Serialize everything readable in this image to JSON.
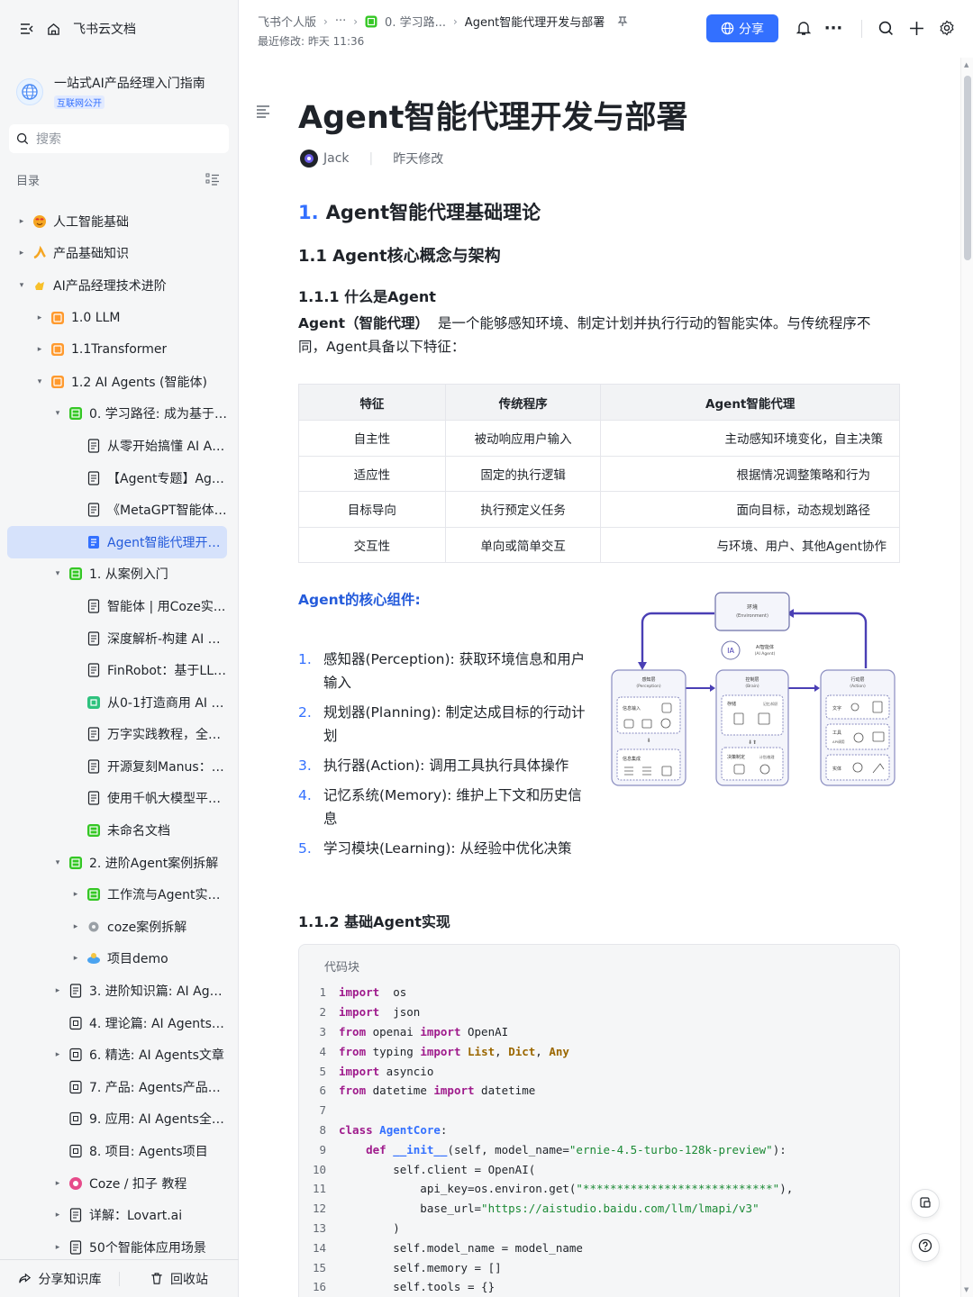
{
  "sidebar": {
    "app_title": "飞书云文档",
    "kb_title": "一站式AI产品经理入门指南",
    "kb_tag": "互联网公开",
    "search_placeholder": "搜索",
    "toc_label": "目录",
    "items": [
      {
        "label": "人工智能基础",
        "level": 0,
        "arrow": "▸",
        "icon": "emoji-red"
      },
      {
        "label": "产品基础知识",
        "level": 0,
        "arrow": "▸",
        "icon": "emoji-orange"
      },
      {
        "label": "AI产品经理技术进阶",
        "level": 0,
        "arrow": "▾",
        "icon": "emoji-yellow"
      },
      {
        "label": "1.0 LLM",
        "level": 1,
        "arrow": "▸",
        "icon": "folder-orange"
      },
      {
        "label": "1.1Transformer",
        "level": 1,
        "arrow": "▸",
        "icon": "folder-orange"
      },
      {
        "label": "1.2 AI Agents (智能体)",
        "level": 1,
        "arrow": "▾",
        "icon": "folder-orange"
      },
      {
        "label": "0. 学习路径: 成为基于A...",
        "level": 2,
        "arrow": "▾",
        "icon": "sheet-green"
      },
      {
        "label": "从零开始搞懂 AI Ag...",
        "level": 3,
        "arrow": "",
        "icon": "doc"
      },
      {
        "label": "【Agent专题】Agen...",
        "level": 3,
        "arrow": "",
        "icon": "doc"
      },
      {
        "label": "《MetaGPT智能体开...",
        "level": 3,
        "arrow": "",
        "icon": "doc"
      },
      {
        "label": "Agent智能代理开发...",
        "level": 3,
        "arrow": "",
        "icon": "doc-blue",
        "active": true
      },
      {
        "label": "1. 从案例入门",
        "level": 2,
        "arrow": "▾",
        "icon": "sheet-green"
      },
      {
        "label": "智能体 | 用Coze实...",
        "level": 3,
        "arrow": "",
        "icon": "doc"
      },
      {
        "label": "深度解析-构建 AI A...",
        "level": 3,
        "arrow": "",
        "icon": "doc"
      },
      {
        "label": "FinRobot：基于LLM...",
        "level": 3,
        "arrow": "",
        "icon": "doc"
      },
      {
        "label": "从0-1打造商用 AI A...",
        "level": 3,
        "arrow": "",
        "icon": "base-green"
      },
      {
        "label": "万字实践教程，全面...",
        "level": 3,
        "arrow": "",
        "icon": "doc"
      },
      {
        "label": "开源复刻Manus：O...",
        "level": 3,
        "arrow": "",
        "icon": "doc"
      },
      {
        "label": "使用千帆大模型平台...",
        "level": 3,
        "arrow": "",
        "icon": "doc"
      },
      {
        "label": "未命名文档",
        "level": 3,
        "arrow": "",
        "icon": "sheet-green"
      },
      {
        "label": "2. 进阶Agent案例拆解",
        "level": 2,
        "arrow": "▾",
        "icon": "sheet-green"
      },
      {
        "label": "工作流与Agent实战...",
        "level": 3,
        "arrow": "▸",
        "icon": "sheet-green"
      },
      {
        "label": "coze案例拆解",
        "level": 3,
        "arrow": "▸",
        "icon": "gear-gray"
      },
      {
        "label": "项目demo",
        "level": 3,
        "arrow": "▸",
        "icon": "emoji-game"
      },
      {
        "label": "3. 进阶知识篇: AI Agen...",
        "level": 2,
        "arrow": "▸",
        "icon": "doc"
      },
      {
        "label": "4. 理论篇: AI Agents理...",
        "level": 2,
        "arrow": "",
        "icon": "mindmap"
      },
      {
        "label": "6. 精选: AI Agents文章",
        "level": 2,
        "arrow": "▸",
        "icon": "mindmap"
      },
      {
        "label": "7. 产品: Agents产品分析",
        "level": 2,
        "arrow": "",
        "icon": "mindmap"
      },
      {
        "label": "9. 应用: AI Agents全景图",
        "level": 2,
        "arrow": "",
        "icon": "mindmap"
      },
      {
        "label": "8. 项目: Agents项目",
        "level": 2,
        "arrow": "",
        "icon": "mindmap"
      },
      {
        "label": "Coze / 扣子 教程",
        "level": 2,
        "arrow": "▸",
        "icon": "coze"
      },
      {
        "label": "详解：Lovart.ai",
        "level": 2,
        "arrow": "▸",
        "icon": "doc"
      },
      {
        "label": "50个智能体应用场景",
        "level": 2,
        "arrow": "▸",
        "icon": "doc"
      }
    ],
    "share_kb": "分享知识库",
    "trash": "回收站"
  },
  "topbar": {
    "crumbs": [
      "飞书个人版",
      "···",
      "0. 学习路...",
      "Agent智能代理开发与部署"
    ],
    "modified": "最近修改: 昨天 11:36",
    "share_label": "分享"
  },
  "doc": {
    "title": "Agent智能代理开发与部署",
    "author": "Jack",
    "edited": "昨天修改",
    "h2_num": "1.",
    "h2_text": "Agent智能代理基础理论",
    "h3": "1.1 Agent核心概念与架构",
    "h4a": "1.1.1 什么是Agent",
    "para_bold": "Agent（智能代理）",
    "para_rest": "是一个能够感知环境、制定计划并执行行动的智能实体。与传统程序不同，Agent具备以下特征：",
    "table": {
      "headers": [
        "特征",
        "传统程序",
        "Agent智能代理"
      ],
      "rows": [
        [
          "自主性",
          "被动响应用户输入",
          "主动感知环境变化，自主决策"
        ],
        [
          "适应性",
          "固定的执行逻辑",
          "根据情况调整策略和行为"
        ],
        [
          "目标导向",
          "执行预定义任务",
          "面向目标，动态规划路径"
        ],
        [
          "交互性",
          "单向或简单交互",
          "与环境、用户、其他Agent协作"
        ]
      ]
    },
    "core_head": "Agent的核心组件:",
    "components": [
      {
        "n": "1.",
        "text": "感知器(Perception): 获取环境信息和用户输入"
      },
      {
        "n": "2.",
        "text": "规划器(Planning): 制定达成目标的行动计划"
      },
      {
        "n": "3.",
        "text": "执行器(Action): 调用工具执行具体操作"
      },
      {
        "n": "4.",
        "text": "记忆系统(Memory): 维护上下文和历史信息"
      },
      {
        "n": "5.",
        "text": "学习模块(Learning): 从经验中优化决策"
      }
    ],
    "diagram": {
      "env": "环境",
      "env_en": "(Environment)",
      "agent": "AI智能体",
      "agent_en": "(AI Agent)",
      "perception": "感知层",
      "perception_en": "(Perception)",
      "brain": "控制层",
      "brain_en": "(Brain)",
      "action": "行动层",
      "action_en": "(Action)",
      "info_in": "信息输入",
      "info_fuse": "信息集成",
      "storage": "存储",
      "memory_knowledge": "记忆/知识",
      "decision": "决策制定",
      "plan_reason": "计划/推理",
      "text": "文字",
      "tools": "工具",
      "api": "API调用",
      "embodied": "实体",
      "logic": "逻辑/推理"
    },
    "h4b": "1.1.2 基础Agent实现",
    "code_label": "代码块"
  },
  "code": [
    [
      [
        "kw",
        "import"
      ],
      [
        "",
        "  os"
      ]
    ],
    [
      [
        "kw",
        "import"
      ],
      [
        "",
        "  json"
      ]
    ],
    [
      [
        "kw",
        "from"
      ],
      [
        "",
        " openai "
      ],
      [
        "kw",
        "import"
      ],
      [
        "",
        " OpenAI"
      ]
    ],
    [
      [
        "kw",
        "from"
      ],
      [
        "",
        " typing "
      ],
      [
        "kw",
        "import"
      ],
      [
        "",
        " "
      ],
      [
        "ty",
        "List"
      ],
      [
        "",
        ", "
      ],
      [
        "ty",
        "Dict"
      ],
      [
        "",
        ", "
      ],
      [
        "ty",
        "Any"
      ]
    ],
    [
      [
        "kw",
        "import"
      ],
      [
        "",
        " asyncio"
      ]
    ],
    [
      [
        "kw",
        "from"
      ],
      [
        "",
        " datetime "
      ],
      [
        "kw",
        "import"
      ],
      [
        "",
        " datetime"
      ]
    ],
    [],
    [
      [
        "kw",
        "class"
      ],
      [
        "",
        " "
      ],
      [
        "cls",
        "AgentCore"
      ],
      [
        "",
        ":"
      ]
    ],
    [
      [
        "",
        "    "
      ],
      [
        "kw",
        "def"
      ],
      [
        "",
        " "
      ],
      [
        "fn",
        "__init__"
      ],
      [
        "",
        "(self, model_name="
      ],
      [
        "str",
        "\"ernie-4.5-turbo-128k-preview\""
      ],
      [
        "",
        "):"
      ]
    ],
    [
      [
        "",
        "        self.client = OpenAI("
      ]
    ],
    [
      [
        "",
        "            api_key=os.environ.get("
      ],
      [
        "str",
        "\"****************************\""
      ],
      [
        "",
        "),"
      ]
    ],
    [
      [
        "",
        "            base_url="
      ],
      [
        "str",
        "\"https://aistudio.baidu.com/llm/lmapi/v3\""
      ]
    ],
    [
      [
        "",
        "        )"
      ]
    ],
    [
      [
        "",
        "        self.model_name = model_name"
      ]
    ],
    [
      [
        "",
        "        self.memory = []"
      ]
    ],
    [
      [
        "",
        "        self.tools = {}"
      ]
    ]
  ]
}
